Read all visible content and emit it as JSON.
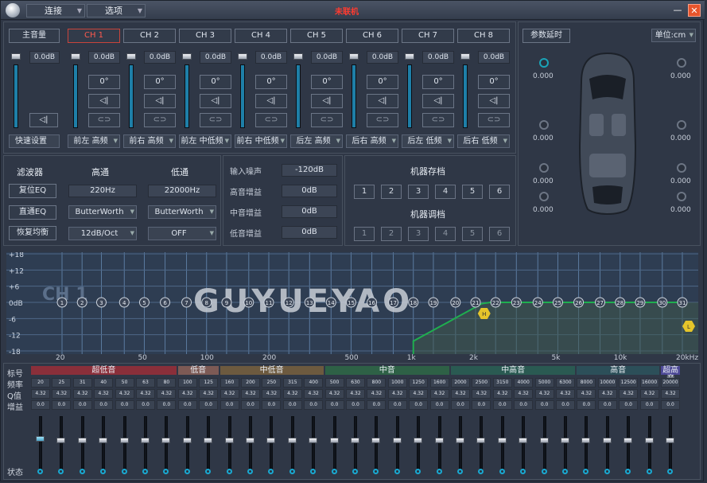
{
  "titlebar": {
    "menus": [
      "连接",
      "选项"
    ],
    "status": "未联机",
    "close": "✕"
  },
  "channel_strip": {
    "master_button": "主音量",
    "master_value": "0.0dB",
    "mute_icon": "speaker-icon",
    "quick_setup": "快速设置",
    "channels": [
      {
        "tab": "CH 1",
        "active": true,
        "gain": "0.0dB",
        "phase": "0°",
        "output": "前左 高频"
      },
      {
        "tab": "CH 2",
        "active": false,
        "gain": "0.0dB",
        "phase": "0°",
        "output": "前右 高频"
      },
      {
        "tab": "CH 3",
        "active": false,
        "gain": "0.0dB",
        "phase": "0°",
        "output": "前左 中低频"
      },
      {
        "tab": "CH 4",
        "active": false,
        "gain": "0.0dB",
        "phase": "0°",
        "output": "前右 中低频"
      },
      {
        "tab": "CH 5",
        "active": false,
        "gain": "0.0dB",
        "phase": "0°",
        "output": "后左 高频"
      },
      {
        "tab": "CH 6",
        "active": false,
        "gain": "0.0dB",
        "phase": "0°",
        "output": "后右 高频"
      },
      {
        "tab": "CH 7",
        "active": false,
        "gain": "0.0dB",
        "phase": "0°",
        "output": "后左 低频"
      },
      {
        "tab": "CH 8",
        "active": false,
        "gain": "0.0dB",
        "phase": "0°",
        "output": "后右 低频"
      }
    ],
    "link_symbol": "⊂⊃"
  },
  "filter": {
    "title": "滤波器",
    "highpass": "高通",
    "lowpass": "低通",
    "reset_eq": "复位EQ",
    "clear_eq": "直通EQ",
    "restore_eq": "恢复均衡",
    "hp_freq": "220Hz",
    "lp_freq": "22000Hz",
    "hp_type": "ButterWorth",
    "lp_type": "ButterWorth",
    "hp_slope": "12dB/Oct",
    "lp_slope": "OFF"
  },
  "noise": {
    "rows": [
      {
        "label": "输入噪声",
        "value": "-120dB"
      },
      {
        "label": "高音增益",
        "value": "0dB"
      },
      {
        "label": "中音增益",
        "value": "0dB"
      },
      {
        "label": "低音增益",
        "value": "0dB"
      }
    ]
  },
  "presets": {
    "save_title": "机器存档",
    "load_title": "机器调档",
    "buttons": [
      "1",
      "2",
      "3",
      "4",
      "5",
      "6"
    ]
  },
  "delay": {
    "button": "参数延时",
    "unit": "单位:cm",
    "values": [
      "0.000",
      "0.000",
      "0.000",
      "0.000",
      "0.000",
      "0.000",
      "0.000",
      "0.000"
    ]
  },
  "graph": {
    "channel_label": "CH 1",
    "watermark": "GUYUEYAO",
    "y_labels": [
      "+18",
      "+12",
      "+6",
      "0dB",
      "-6",
      "-12",
      "-18"
    ],
    "x_labels": [
      "20",
      "50",
      "100",
      "200",
      "500",
      "1k",
      "2k",
      "5k",
      "10k",
      "20kHz"
    ],
    "point_count": 31,
    "hp_marker": "H",
    "lp_marker": "L"
  },
  "eq": {
    "row_labels": [
      "标号",
      "频率",
      "Q值",
      "增益",
      "状态"
    ],
    "bands": [
      {
        "name": "超低音",
        "span": [
          1,
          7
        ],
        "color": "#8a2f3a"
      },
      {
        "name": "低音",
        "span": [
          8,
          9
        ],
        "color": "#7d5a55"
      },
      {
        "name": "中低音",
        "span": [
          10,
          14
        ],
        "color": "#6d5a3f"
      },
      {
        "name": "中音",
        "span": [
          15,
          20
        ],
        "color": "#2e6146"
      },
      {
        "name": "中高音",
        "span": [
          21,
          26
        ],
        "color": "#2a5a52"
      },
      {
        "name": "高音",
        "span": [
          27,
          30
        ],
        "color": "#2c4f59"
      },
      {
        "name": "超高音",
        "span": [
          31,
          31
        ],
        "color": "#4c4896"
      }
    ],
    "freqs": [
      "20",
      "25",
      "31",
      "40",
      "50",
      "63",
      "80",
      "100",
      "125",
      "160",
      "200",
      "250",
      "315",
      "400",
      "500",
      "630",
      "800",
      "1000",
      "1250",
      "1600",
      "2000",
      "2500",
      "3150",
      "4000",
      "5000",
      "6300",
      "8000",
      "10000",
      "12500",
      "16000",
      "20000"
    ],
    "q": "4.32",
    "gain": "0.0"
  }
}
